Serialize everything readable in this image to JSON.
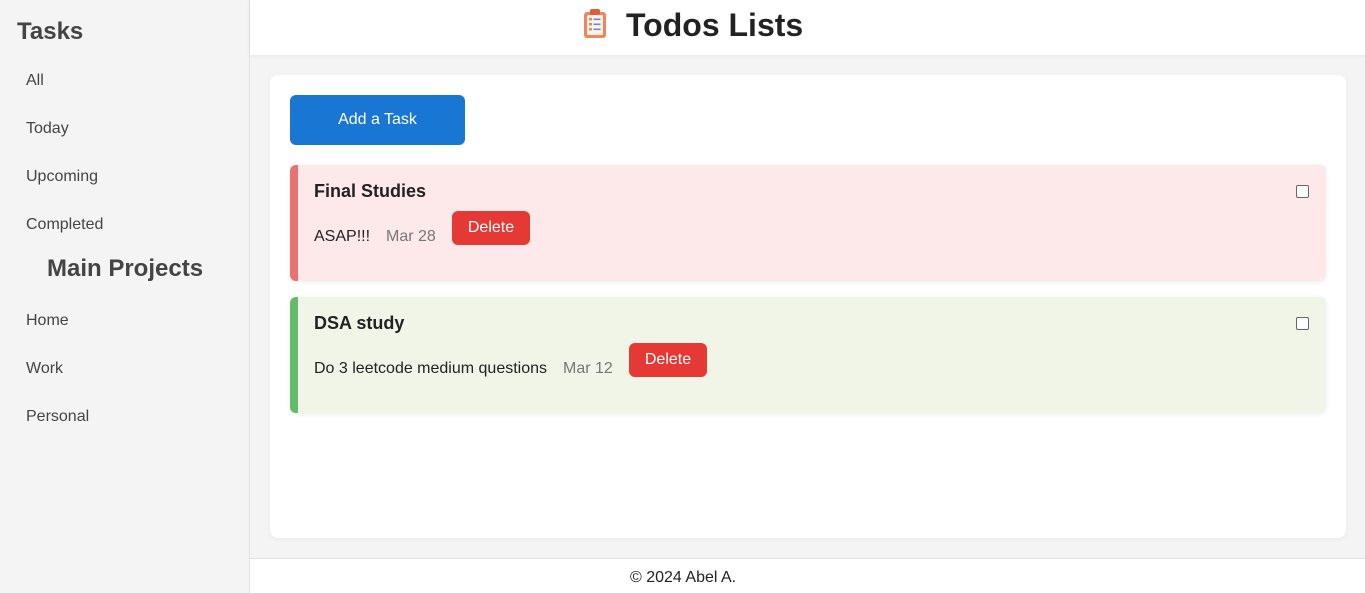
{
  "sidebar": {
    "tasks_heading": "Tasks",
    "task_filters": [
      {
        "label": "All"
      },
      {
        "label": "Today"
      },
      {
        "label": "Upcoming"
      },
      {
        "label": "Completed"
      }
    ],
    "projects_heading": "Main Projects",
    "projects": [
      {
        "label": "Home"
      },
      {
        "label": "Work"
      },
      {
        "label": "Personal"
      }
    ]
  },
  "header": {
    "icon": "clipboard-todo-icon",
    "title": "Todos Lists"
  },
  "main": {
    "add_task_label": "Add a Task",
    "tasks": [
      {
        "title": "Final Studies",
        "description": "ASAP!!!",
        "date": "Mar 28",
        "delete_label": "Delete",
        "completed": false,
        "background": "#fde8ea",
        "accent": "#e57373"
      },
      {
        "title": "DSA study",
        "description": "Do 3 leetcode medium questions",
        "date": "Mar 12",
        "delete_label": "Delete",
        "completed": false,
        "background": "#f0f5e8",
        "accent": "#66bb6a"
      }
    ]
  },
  "footer": {
    "text": "© 2024 Abel A."
  },
  "colors": {
    "primary_button": "#1976d2",
    "delete_button": "#e53935"
  }
}
